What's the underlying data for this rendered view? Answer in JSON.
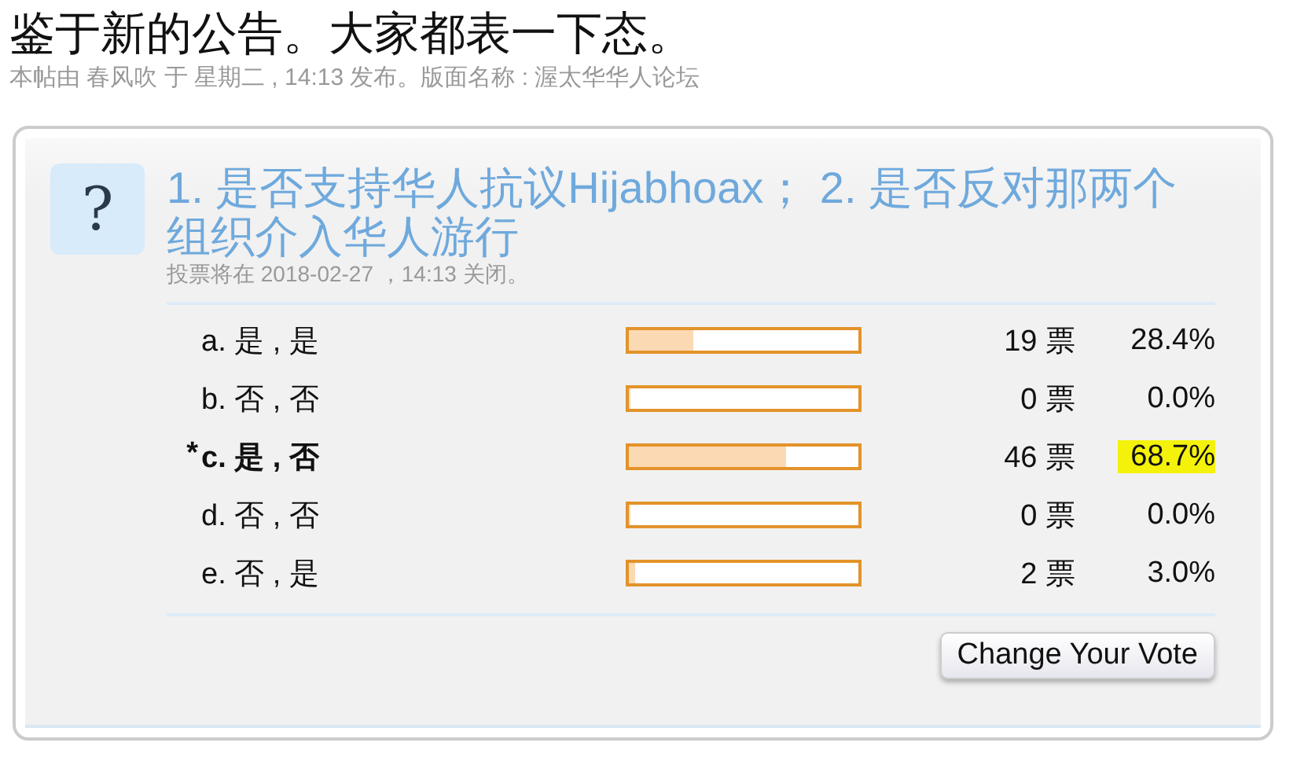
{
  "topic": {
    "title": "鉴于新的公告。大家都表一下态。",
    "byline": "本帖由 春风吹 于 星期二 , 14:13 发布。版面名称 : 渥太华华人论坛"
  },
  "poll": {
    "icon": "?",
    "question": "1. 是否支持华人抗议Hijabhoax； 2. 是否反对那两个组织介入华人游行",
    "closing": "投票将在 2018-02-27 ，14:13 关闭。",
    "options": [
      {
        "letter": "a.",
        "label": "是 , 是",
        "selected": false,
        "level": 0.284,
        "votes": "19 票",
        "percent": "28.4%",
        "highlighted": false
      },
      {
        "letter": "b.",
        "label": "否 , 否",
        "selected": false,
        "level": 0,
        "votes": "0 票",
        "percent": "0.0%",
        "highlighted": false
      },
      {
        "mark": "*",
        "letter": "c.",
        "label": "是 , 否",
        "selected": true,
        "level": 0.687,
        "votes": "46 票",
        "percent": "68.7%",
        "highlighted": true
      },
      {
        "letter": "d.",
        "label": "否 , 否",
        "selected": false,
        "level": 0,
        "votes": "0 票",
        "percent": "0.0%",
        "highlighted": false
      },
      {
        "letter": "e.",
        "label": "否 , 是",
        "selected": false,
        "level": 0.03,
        "votes": "2 票",
        "percent": "3.0%",
        "highlighted": false
      }
    ],
    "button": "Change Your Vote"
  }
}
